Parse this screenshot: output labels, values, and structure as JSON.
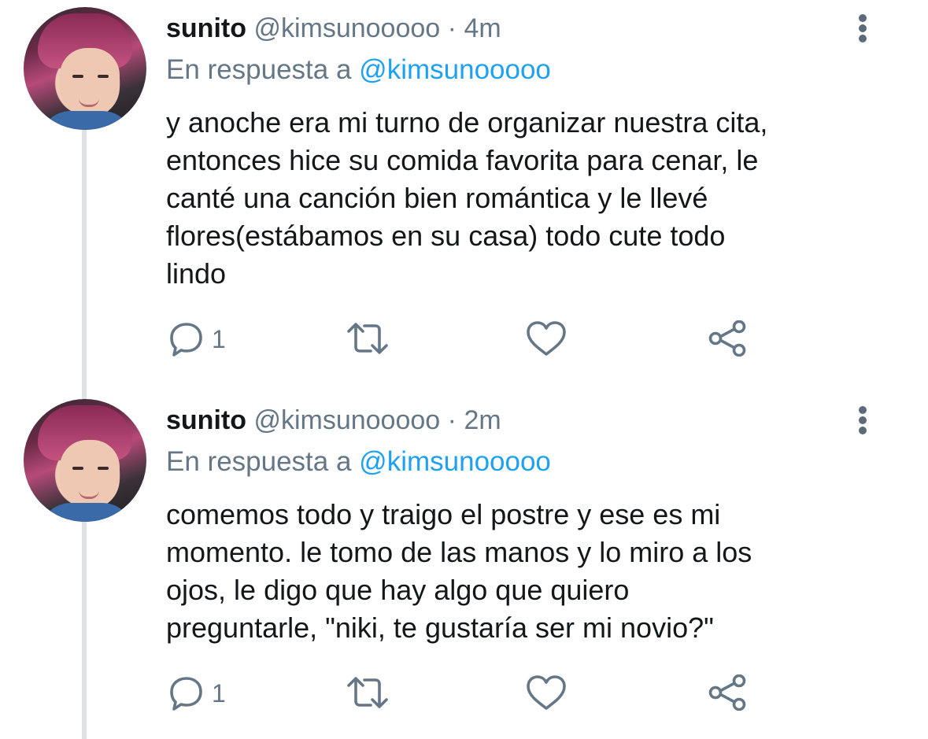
{
  "tweets": [
    {
      "display_name": "sunito",
      "handle": "@kimsunooooo",
      "separator": "·",
      "time": "4m",
      "reply_prefix": "En respuesta a",
      "reply_to": "@kimsunooooo",
      "text_lines": [
        "y anoche era mi turno de organizar nuestra cita,",
        "entonces hice su comida favorita para cenar, le",
        "canté una canción bien romántica y le llevé",
        "flores(estábamos en su casa) todo cute todo",
        "lindo"
      ],
      "reply_count": "1"
    },
    {
      "display_name": "sunito",
      "handle": "@kimsunooooo",
      "separator": "·",
      "time": "2m",
      "reply_prefix": "En respuesta a",
      "reply_to": "@kimsunooooo",
      "text_lines": [
        "comemos todo y traigo el postre y ese es mi",
        "momento. le tomo de las manos y lo miro a los",
        "ojos, le digo que hay algo que quiero",
        "preguntarle, \"niki, te gustaría ser mi novio?\""
      ],
      "reply_count": "1"
    }
  ],
  "icons": {
    "reply": "comment-icon",
    "retweet": "retweet-icon",
    "like": "heart-icon",
    "share": "share-icon",
    "more": "more-vertical-icon"
  },
  "colors": {
    "mention": "#1da1f2",
    "muted": "#657786",
    "text": "#14171a",
    "thread_line": "#dfe3e6"
  }
}
